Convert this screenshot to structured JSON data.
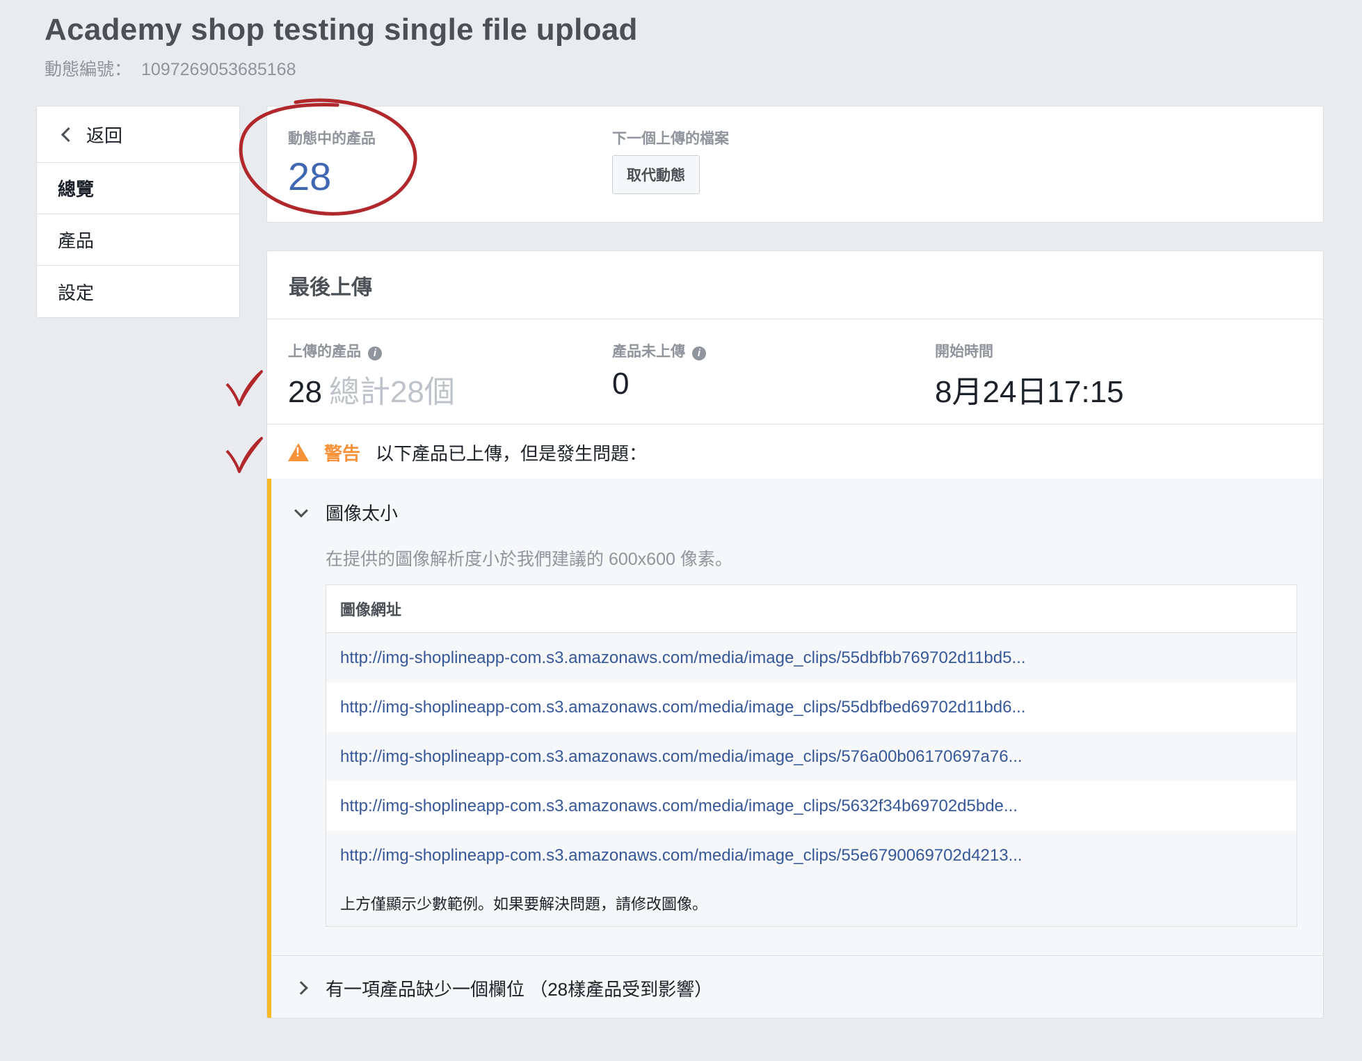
{
  "header": {
    "title": "Academy shop testing single file upload",
    "feed_id_label": "動態編號：",
    "feed_id": "1097269053685168"
  },
  "sidebar": {
    "back_label": "返回",
    "items": [
      {
        "label": "總覽",
        "active": true
      },
      {
        "label": "產品",
        "active": false
      },
      {
        "label": "設定",
        "active": false
      }
    ]
  },
  "summary": {
    "active_products_label": "動態中的產品",
    "active_products_count": "28",
    "next_upload_label": "下一個上傳的檔案",
    "replace_button": "取代動態"
  },
  "last_upload": {
    "title": "最後上傳",
    "uploaded_label": "上傳的產品",
    "uploaded_value": "28",
    "uploaded_total": "總計28個",
    "not_uploaded_label": "產品未上傳",
    "not_uploaded_value": "0",
    "start_time_label": "開始時間",
    "start_time_value": "8月24日17:15"
  },
  "warning": {
    "label": "警告",
    "text": "以下產品已上傳，但是發生問題："
  },
  "issues": {
    "image_small": {
      "title": "圖像太小",
      "description": "在提供的圖像解析度小於我們建議的 600x600 像素。",
      "table_header": "圖像網址",
      "urls": [
        "http://img-shoplineapp-com.s3.amazonaws.com/media/image_clips/55dbfbb769702d11bd5...",
        "http://img-shoplineapp-com.s3.amazonaws.com/media/image_clips/55dbfbed69702d11bd6...",
        "http://img-shoplineapp-com.s3.amazonaws.com/media/image_clips/576a00b06170697a76...",
        "http://img-shoplineapp-com.s3.amazonaws.com/media/image_clips/5632f34b69702d5bde...",
        "http://img-shoplineapp-com.s3.amazonaws.com/media/image_clips/55e6790069702d4213..."
      ],
      "footer": "上方僅顯示少數範例。如果要解決問題，請修改圖像。"
    },
    "missing_field": {
      "title": "有一項產品缺少一個欄位 （28樣產品受到影響）"
    }
  },
  "annotation_color": "#b0272c"
}
